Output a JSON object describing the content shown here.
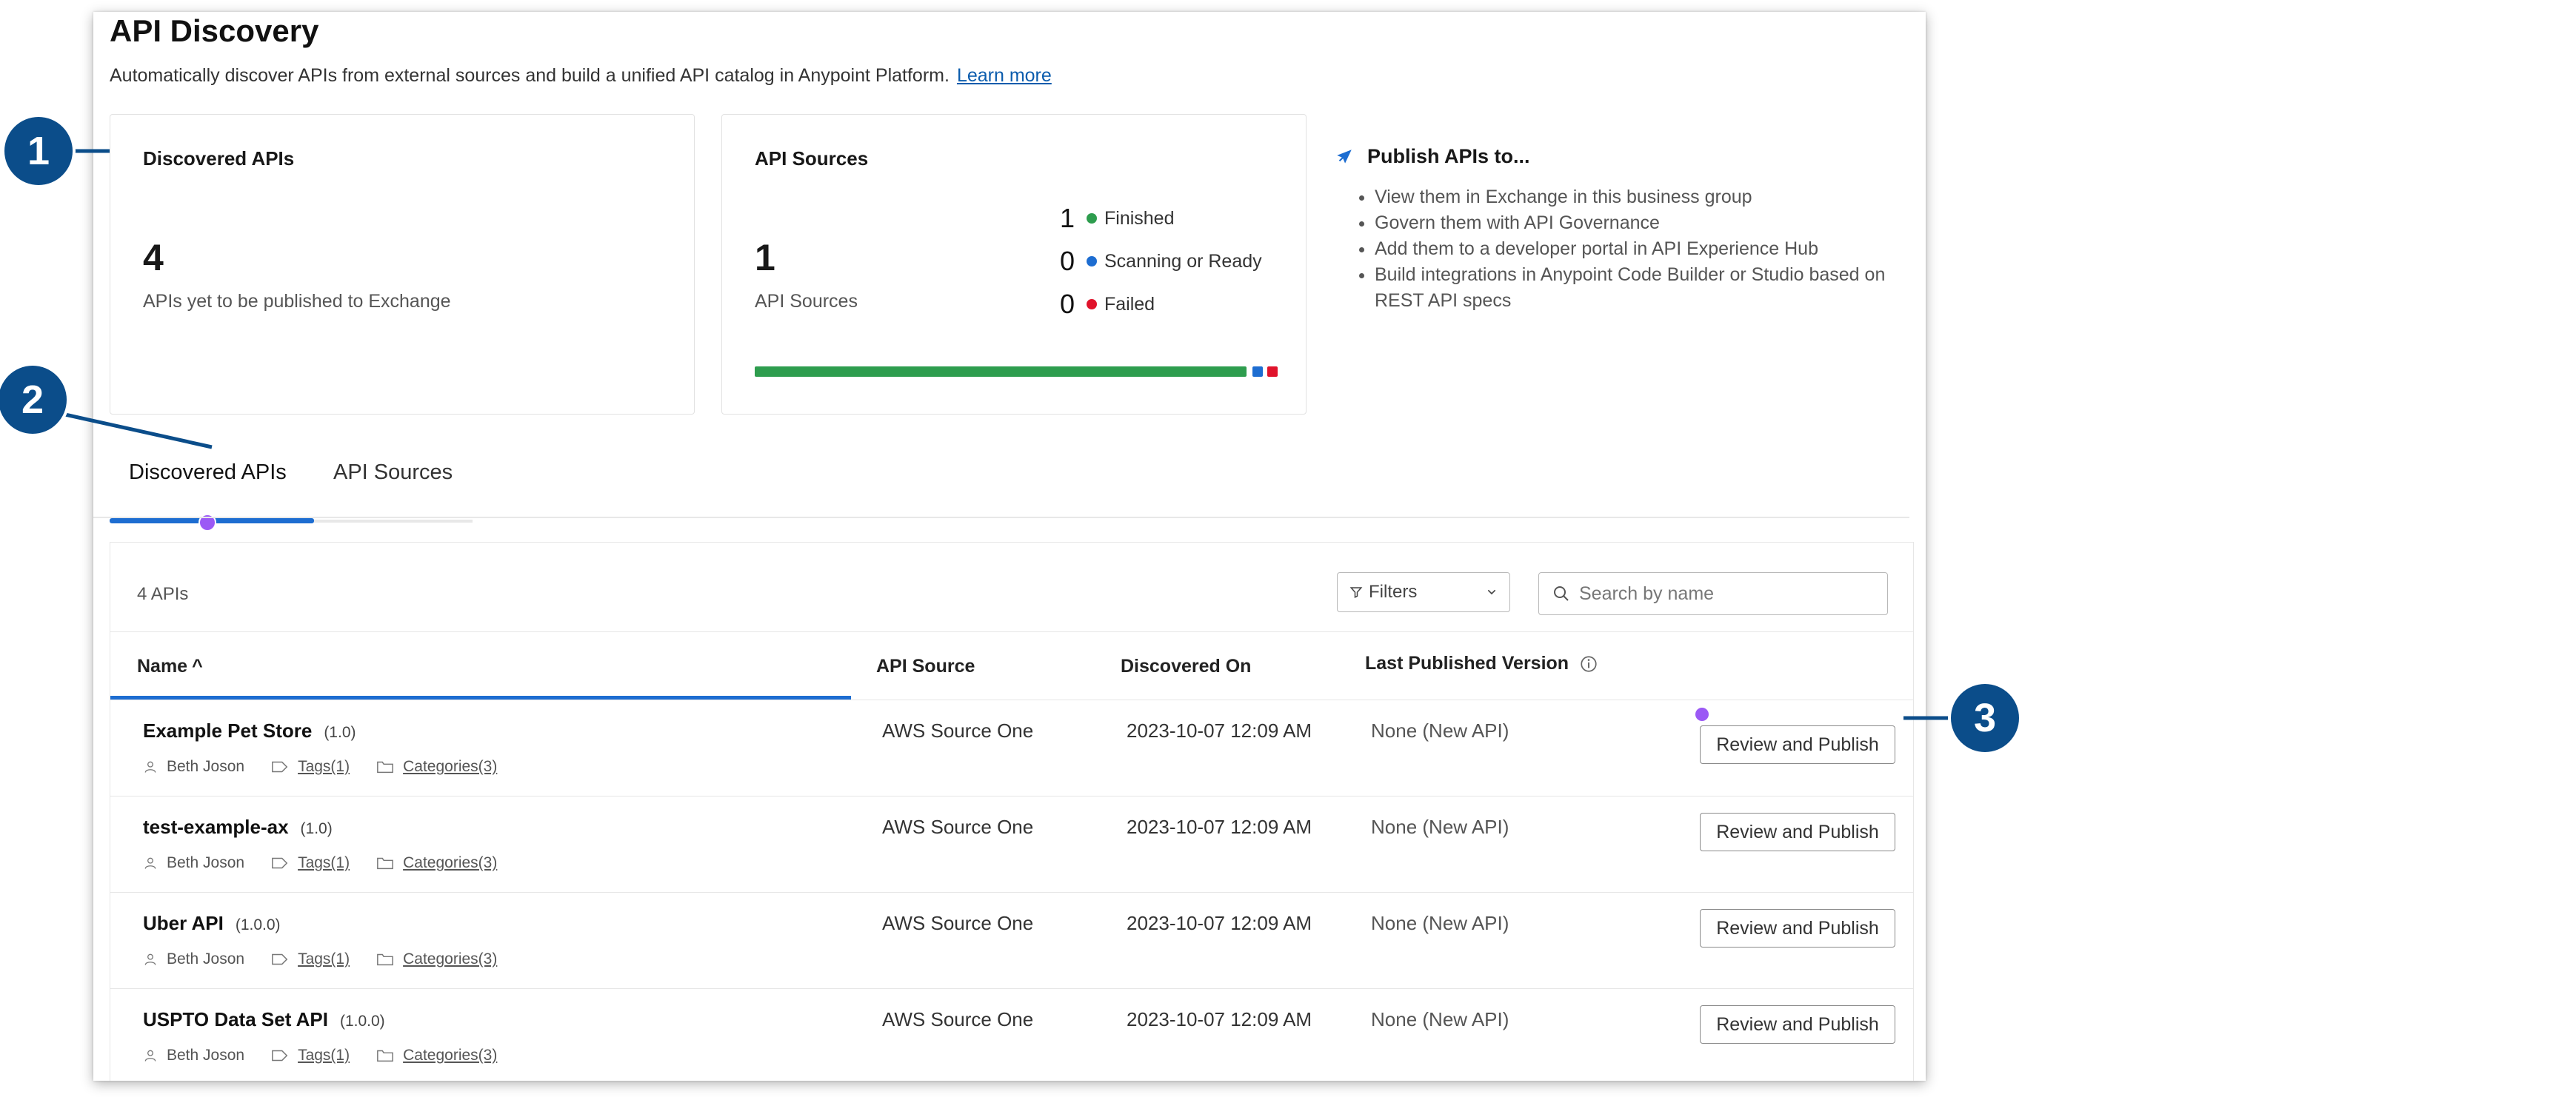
{
  "header": {
    "title": "API Discovery",
    "subtitle": "Automatically discover APIs from external sources and build a unified API catalog in Anypoint Platform.",
    "learn_more": "Learn more"
  },
  "summary": {
    "discovered": {
      "title": "Discovered APIs",
      "count": "4",
      "label": "APIs yet to be published to Exchange"
    },
    "sources": {
      "title": "API Sources",
      "count": "1",
      "label": "API Sources",
      "stats": [
        {
          "value": "1",
          "label": "Finished",
          "color": "#2e9d4e"
        },
        {
          "value": "0",
          "label": "Scanning or Ready",
          "color": "#1d6dd1"
        },
        {
          "value": "0",
          "label": "Failed",
          "color": "#e0132b"
        }
      ]
    },
    "publish": {
      "title": "Publish APIs to...",
      "items": [
        "View them in Exchange in this business group",
        "Govern them with API Governance",
        "Add them to a developer portal in API Experience Hub",
        "Build integrations in Anypoint Code Builder or Studio based on REST API specs"
      ]
    }
  },
  "tabs": [
    {
      "label": "Discovered APIs"
    },
    {
      "label": "API Sources"
    }
  ],
  "table": {
    "count_label": "4 APIs",
    "filters_label": "Filters",
    "search_placeholder": "Search by name",
    "columns": {
      "name": "Name",
      "sort": "^",
      "source": "API Source",
      "discovered": "Discovered On",
      "version": "Last Published Version"
    },
    "rows": [
      {
        "name": "Example Pet Store",
        "version": "(1.0)",
        "owner": "Beth Joson",
        "tags": "Tags(1)",
        "categories": "Categories(3)",
        "source": "AWS Source One",
        "discovered": "2023-10-07 12:09 AM",
        "published": "None (New API)",
        "action": "Review and Publish"
      },
      {
        "name": "test-example-ax",
        "version": "(1.0)",
        "owner": "Beth Joson",
        "tags": "Tags(1)",
        "categories": "Categories(3)",
        "source": "AWS Source One",
        "discovered": "2023-10-07 12:09 AM",
        "published": "None (New API)",
        "action": "Review and Publish"
      },
      {
        "name": "Uber API",
        "version": "(1.0.0)",
        "owner": "Beth Joson",
        "tags": "Tags(1)",
        "categories": "Categories(3)",
        "source": "AWS Source One",
        "discovered": "2023-10-07 12:09 AM",
        "published": "None (New API)",
        "action": "Review and Publish"
      },
      {
        "name": "USPTO Data Set API",
        "version": "(1.0.0)",
        "owner": "Beth Joson",
        "tags": "Tags(1)",
        "categories": "Categories(3)",
        "source": "AWS Source One",
        "discovered": "2023-10-07 12:09 AM",
        "published": "None (New API)",
        "action": "Review and Publish"
      }
    ]
  },
  "callouts": [
    "1",
    "2",
    "3"
  ],
  "colors": {
    "accent": "#1d6dd1",
    "callout": "#0b4d8a",
    "highlight": "#9b59f5"
  }
}
